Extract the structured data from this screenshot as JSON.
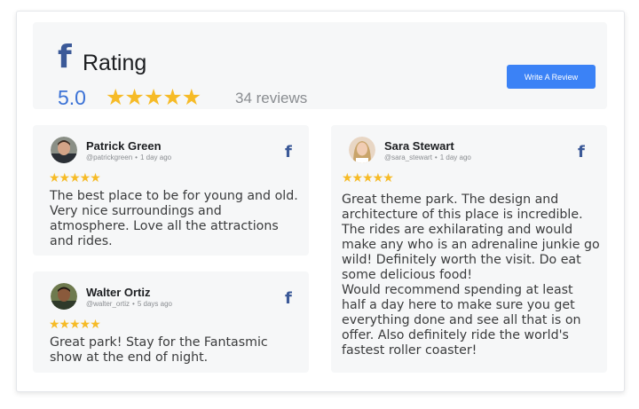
{
  "header": {
    "title": "Rating",
    "score": "5.0",
    "stars": "★★★★★",
    "review_count": "34 reviews",
    "write_button_label": "Write A Review",
    "fb_icon": "f"
  },
  "reviews": [
    {
      "name": "Patrick Green",
      "handle": "@patrickgreen",
      "time": "1 day ago",
      "stars": "★★★★★",
      "lines": [
        "The best place to be for young and old.",
        "Very nice surroundings and",
        "atmosphere. Love all the attractions",
        "and rides."
      ]
    },
    {
      "name": "Walter Ortiz",
      "handle": "@walter_ortiz",
      "time": "5 days ago",
      "stars": "★★★★★",
      "lines": [
        "Great park! Stay for the Fantasmic",
        "show at the end of night."
      ]
    },
    {
      "name": "Sara Stewart",
      "handle": "@sara_stewart",
      "time": "1 day ago",
      "stars": "★★★★★",
      "lines": [
        "Great theme park. The design and",
        "architecture of this place is incredible.",
        "The rides are exhilarating and would",
        "make any who is an adrenaline junkie go",
        "wild! Definitely worth the visit. Do eat",
        "some delicious food!",
        "Would recommend spending at least",
        "half a day here to make sure you get",
        "everything done and see all that is on",
        "offer. Also definitely ride the world's",
        "fastest roller coaster!"
      ]
    }
  ],
  "colors": {
    "facebook_blue": "#3b5998",
    "star_yellow": "#f6bb27",
    "button_blue": "#3b82f6",
    "score_blue": "#3b72d6"
  },
  "icons": [
    "facebook-icon",
    "star-icon",
    "avatar"
  ]
}
